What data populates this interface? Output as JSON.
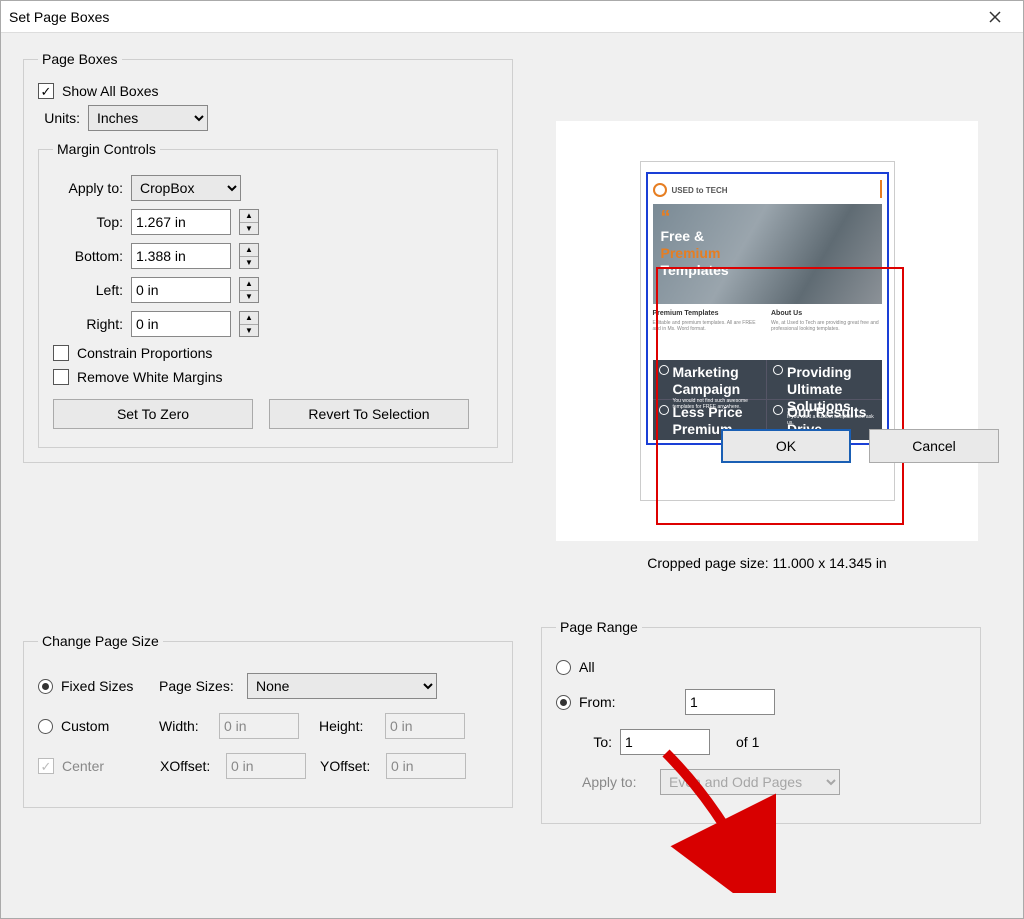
{
  "title": "Set Page Boxes",
  "page_boxes": {
    "legend": "Page Boxes",
    "show_all_label": "Show All Boxes",
    "show_all_checked": true,
    "units_label": "Units:",
    "units_value": "Inches",
    "margin": {
      "legend": "Margin Controls",
      "apply_to_label": "Apply to:",
      "apply_to_value": "CropBox",
      "top_label": "Top:",
      "top_value": "1.267 in",
      "bottom_label": "Bottom:",
      "bottom_value": "1.388 in",
      "left_label": "Left:",
      "left_value": "0 in",
      "right_label": "Right:",
      "right_value": "0 in",
      "constrain_label": "Constrain Proportions",
      "remove_white_label": "Remove White Margins",
      "set_zero_label": "Set To Zero",
      "revert_label": "Revert To Selection"
    }
  },
  "preview": {
    "cropped_label": "Cropped page size: 11.000 x 14.345 in",
    "doc": {
      "brand": "USED to TECH",
      "head1": "Free &",
      "head2": "Premium",
      "head3": "Templates",
      "sec1_title": "Premium Templates",
      "sec2_title": "About Us",
      "q1_title": "Marketing Campaign",
      "q2_title": "Providing Ultimate Solutions",
      "q3_title": "Less Price Premium Quality",
      "q4_title": "Our Results Drive Revenues"
    }
  },
  "change_size": {
    "legend": "Change Page Size",
    "fixed_label": "Fixed Sizes",
    "page_sizes_label": "Page Sizes:",
    "page_sizes_value": "None",
    "custom_label": "Custom",
    "width_label": "Width:",
    "width_value": "0 in",
    "height_label": "Height:",
    "height_value": "0 in",
    "center_label": "Center",
    "xoffset_label": "XOffset:",
    "xoffset_value": "0 in",
    "yoffset_label": "YOffset:",
    "yoffset_value": "0 in"
  },
  "page_range": {
    "legend": "Page Range",
    "all_label": "All",
    "from_label": "From:",
    "from_value": "1",
    "to_label": "To:",
    "to_value": "1",
    "of_label": "of 1",
    "apply_to_label": "Apply to:",
    "apply_to_value": "Even and Odd Pages"
  },
  "footer": {
    "ok_label": "OK",
    "cancel_label": "Cancel"
  }
}
